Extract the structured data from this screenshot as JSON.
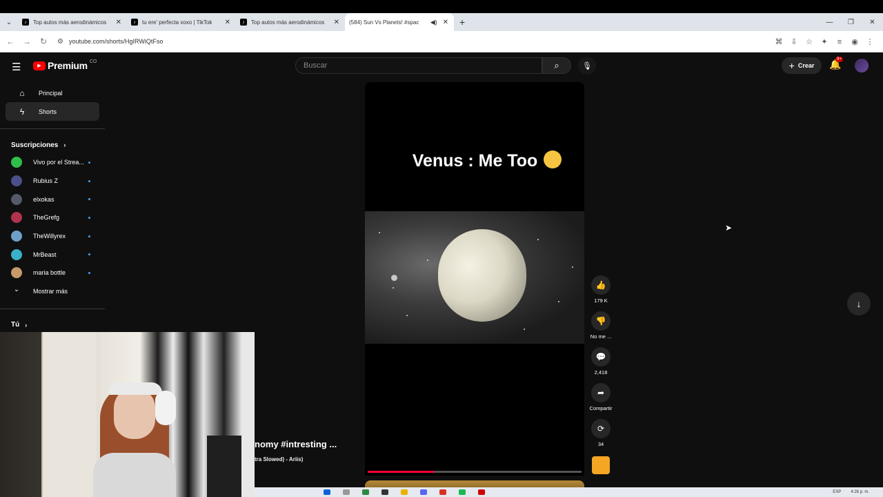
{
  "browser": {
    "tabs": [
      {
        "title": "Top autos más aerodinámicos",
        "favicon": "tiktok-icon",
        "active": false
      },
      {
        "title": "tu ere' perfecta xoxo | TikTok",
        "favicon": "tiktok-icon",
        "active": false
      },
      {
        "title": "Top autos más aerodinámicos",
        "favicon": "tiktok-icon",
        "active": false
      },
      {
        "title": "(584) Sun Vs Planets! #spac",
        "favicon": "youtube-icon",
        "active": true
      }
    ],
    "url": "youtube.com/shorts/HgIRWiQtFso"
  },
  "masthead": {
    "logo_text": "Premium",
    "country": "CO",
    "search_placeholder": "Buscar",
    "create_label": "Crear",
    "notif_badge": "9+"
  },
  "sidebar": {
    "items": [
      {
        "label": "Principal",
        "icon": "home-icon"
      },
      {
        "label": "Shorts",
        "icon": "shorts-icon"
      }
    ],
    "subs_header": "Suscripciones",
    "subscriptions": [
      {
        "name": "Vivo por el Strea...",
        "color": "#2fbf4a"
      },
      {
        "name": "Rubius Z",
        "color": "#4b4f8a"
      },
      {
        "name": "elxokas",
        "color": "#555a6a"
      },
      {
        "name": "TheGrefg",
        "color": "#b0324e"
      },
      {
        "name": "TheWillyrex",
        "color": "#6fa0c8"
      },
      {
        "name": "MrBeast",
        "color": "#3ab0c8"
      },
      {
        "name": "maria bottle",
        "color": "#c79a6a"
      }
    ],
    "show_more": "Mostrar más",
    "you_header": "Tú"
  },
  "short": {
    "overlay_text": "Venus : Me Too",
    "title_fragment": "nomy #intresting ...",
    "audio_fragment": "tra Slowed) - Ariis)",
    "progress": 0.31
  },
  "actions": {
    "likes": "179 K",
    "dislike": "No me ...",
    "comments": "2,418",
    "share": "Compartir",
    "remix": "34"
  },
  "taskbar": {
    "lang": "ESP",
    "time": "4:26 p. m."
  }
}
